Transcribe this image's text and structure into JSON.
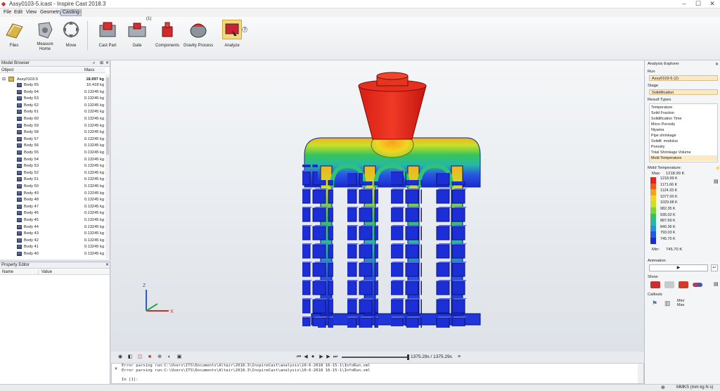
{
  "window": {
    "title": "Assy0103-5.icast - Inspire Cast 2018.3",
    "minimize": "–",
    "maximize": "☐",
    "close": "✕"
  },
  "menu": [
    "File",
    "Edit",
    "View",
    "Geometry",
    "Casting"
  ],
  "menu_active": "Casting",
  "ribbon": {
    "tools": [
      {
        "label": "Files",
        "icon": "files-icon"
      },
      {
        "label": "Measure\nHome",
        "icon": "measure-icon"
      },
      {
        "label": "Move",
        "icon": "move-icon"
      },
      {
        "label": "Cast Part",
        "icon": "cast-part-icon"
      },
      {
        "label": "Gate",
        "icon": "gate-icon",
        "badge": "(1)"
      },
      {
        "label": "Components",
        "icon": "components-icon"
      },
      {
        "label": "Gravity Process",
        "icon": "gravity-process-icon"
      },
      {
        "label": "Analyze",
        "icon": "analyze-icon",
        "badge": "3"
      }
    ]
  },
  "model_browser": {
    "title": "Model Browser",
    "col_object": "Object",
    "col_mass": "Mass",
    "root": {
      "name": "Assy0103-5",
      "mass": "18.997 kg"
    },
    "rows": [
      {
        "name": "Body 65",
        "mass": "10.418 kg"
      },
      {
        "name": "Body 64",
        "mass": "0.13245 kg"
      },
      {
        "name": "Body 63",
        "mass": "0.13245 kg"
      },
      {
        "name": "Body 62",
        "mass": "0.13245 kg"
      },
      {
        "name": "Body 61",
        "mass": "0.13245 kg"
      },
      {
        "name": "Body 60",
        "mass": "0.13245 kg"
      },
      {
        "name": "Body 59",
        "mass": "0.13245 kg"
      },
      {
        "name": "Body 58",
        "mass": "0.13245 kg"
      },
      {
        "name": "Body 57",
        "mass": "0.13245 kg"
      },
      {
        "name": "Body 56",
        "mass": "0.13245 kg"
      },
      {
        "name": "Body 55",
        "mass": "0.13245 kg"
      },
      {
        "name": "Body 54",
        "mass": "0.13245 kg"
      },
      {
        "name": "Body 53",
        "mass": "0.13245 kg"
      },
      {
        "name": "Body 52",
        "mass": "0.13245 kg"
      },
      {
        "name": "Body 51",
        "mass": "0.13245 kg"
      },
      {
        "name": "Body 50",
        "mass": "0.13245 kg"
      },
      {
        "name": "Body 49",
        "mass": "0.13245 kg"
      },
      {
        "name": "Body 48",
        "mass": "0.13245 kg"
      },
      {
        "name": "Body 47",
        "mass": "0.13245 kg"
      },
      {
        "name": "Body 46",
        "mass": "0.13245 kg"
      },
      {
        "name": "Body 45",
        "mass": "0.13245 kg"
      },
      {
        "name": "Body 44",
        "mass": "0.13245 kg"
      },
      {
        "name": "Body 43",
        "mass": "0.13245 kg"
      },
      {
        "name": "Body 42",
        "mass": "0.13245 kg"
      },
      {
        "name": "Body 41",
        "mass": "0.13245 kg"
      },
      {
        "name": "Body 40",
        "mass": "0.13245 kg"
      }
    ]
  },
  "property_editor": {
    "title": "Property Editor",
    "col_name": "Name",
    "col_value": "Value"
  },
  "playback": {
    "time": "1375.29s / 1375.29s"
  },
  "console": {
    "line1": "Error parsing run:C:\\Users\\ITS\\Documents\\Altair\\2018.3\\InspireCast\\analysis\\10-6-2018 16-15-1\\InfoRun.xml",
    "line2": "Error parsing run:C:\\Users\\ITS\\Documents\\Altair\\2018.3\\InspireCast\\analysis\\10-6-2018 16-15-1\\InfoRun.xml",
    "prompt": "In [1]:"
  },
  "status": {
    "units": "MMKS (mm kg N s)"
  },
  "analysis_explorer": {
    "title": "Analysis Explorer",
    "run_label": "Run",
    "run_value": "Assy0103-5 (2)",
    "stage_label": "Stage",
    "stage_value": "Solidification",
    "result_types_label": "Result Types",
    "result_types": [
      "Temperature",
      "Solid Fraction",
      "Solidification Time",
      "Micro Porosity",
      "Niyama",
      "Pipe shrinkage",
      "Solidif. modulus",
      "Porosity",
      "Total Shrinkage Volume",
      "Mold Temperature"
    ],
    "selected_result": "Mold Temperature",
    "legend_title": "Mold Temperature:",
    "max_label": "Max:",
    "max_value": "1218.99 K",
    "min_label": "Min:",
    "min_value": "745.70 K",
    "legend_values": [
      "1218.99 K",
      "1171.66 K",
      "1124.33 K",
      "1077.00 K",
      "1029.68 K",
      "982.35 K",
      "935.02 K",
      "887.69 K",
      "840.36 K",
      "793.03 K",
      "745.70 K"
    ],
    "legend_colors": [
      "#e8211b",
      "#f05a1a",
      "#f6a21c",
      "#f4d41e",
      "#c8e02a",
      "#7fd23a",
      "#36c45a",
      "#25b8a8",
      "#2a8ee0",
      "#2a55e0",
      "#1a2ad0"
    ],
    "animation_label": "Animation",
    "show_label": "Show",
    "callouts_label": "Callouts",
    "minmax_label": "Min/\nMax"
  },
  "colors": {
    "hot": "#e8211b",
    "warm": "#f6a21c",
    "mid": "#36c45a",
    "cool": "#1a2ad0"
  }
}
